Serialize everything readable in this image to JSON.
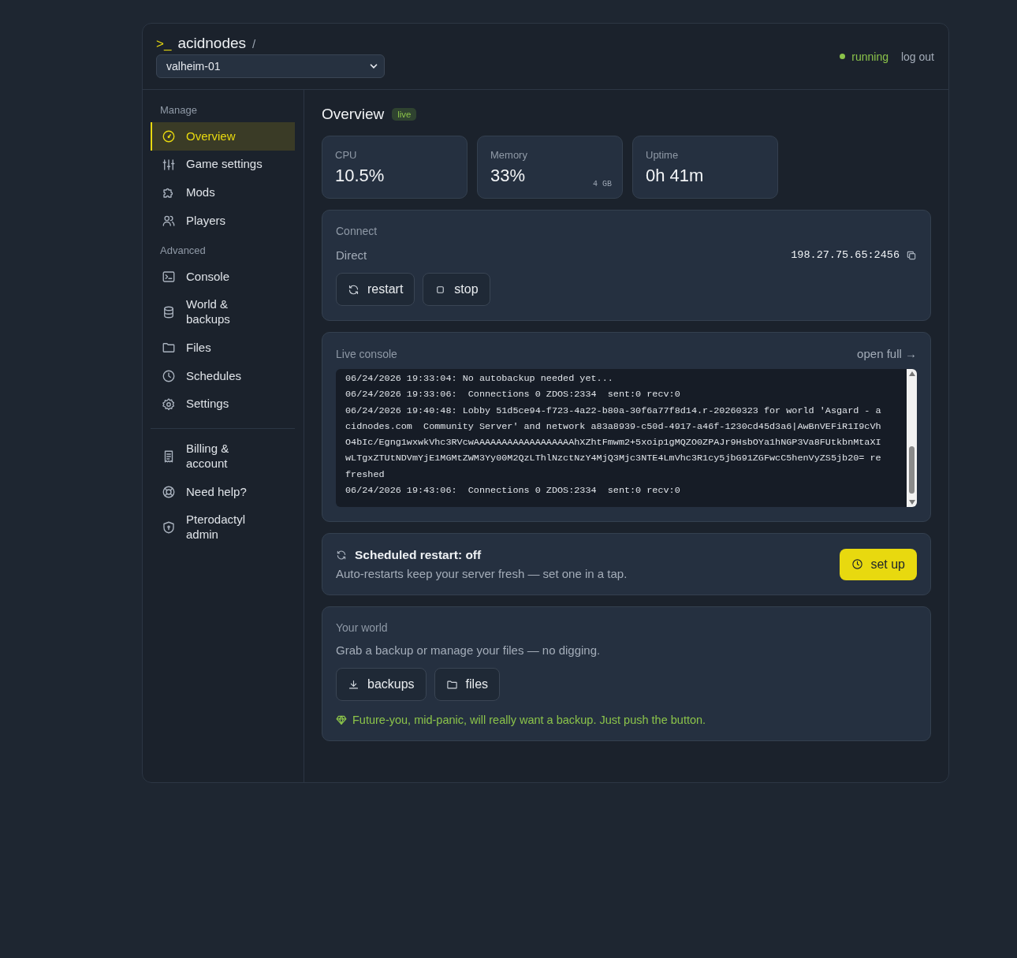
{
  "header": {
    "brand_prompt": ">_",
    "brand": "acidnodes",
    "separator": "/",
    "server_select": {
      "value": "valheim-01"
    },
    "status": {
      "label": "running",
      "color": "#8bc34a"
    },
    "logout": "log out"
  },
  "sidebar": {
    "sections": [
      {
        "title": "Manage",
        "items": [
          {
            "label": "Overview",
            "selected": true
          },
          {
            "label": "Game settings",
            "selected": false
          },
          {
            "label": "Mods",
            "selected": false
          },
          {
            "label": "Players",
            "selected": false
          }
        ]
      },
      {
        "title": "Advanced",
        "items": [
          {
            "label": "Console",
            "selected": false
          },
          {
            "label": "World & backups",
            "selected": false
          },
          {
            "label": "Files",
            "selected": false
          },
          {
            "label": "Schedules",
            "selected": false
          },
          {
            "label": "Settings",
            "selected": false
          }
        ]
      },
      {
        "items": [
          {
            "label": "Billing & account",
            "selected": false
          },
          {
            "label": "Need help?",
            "selected": false
          },
          {
            "label": "Pterodactyl admin",
            "selected": false
          }
        ]
      }
    ]
  },
  "main": {
    "title": "Overview",
    "badge": "live",
    "stats": [
      {
        "label": "CPU",
        "value": "10.5%"
      },
      {
        "label": "Memory",
        "value": "33%",
        "note": "4 GB"
      },
      {
        "label": "Uptime",
        "value": "0h 41m"
      }
    ],
    "connect": {
      "title": "Connect",
      "label": "Direct",
      "address": "198.27.75.65:2456",
      "buttons": [
        {
          "label": "restart"
        },
        {
          "label": "stop"
        }
      ]
    },
    "console": {
      "title": "Live console",
      "link": "open full →",
      "lines": [
        "06/24/2026 19:33:04: No autobackup needed yet...",
        "06/24/2026 19:33:06:  Connections 0 ZDOS:2334  sent:0 recv:0",
        "06/24/2026 19:40:48: Lobby 51d5ce94-f723-4a22-b80a-30f6a77f8d14.r-20260323 for world 'Asgard - acidnodes.com  Community Server' and network a83a8939-c50d-4917-a46f-1230cd45d3a6|AwBnVEFiR1I9cVhO4bIc/Egng1wxwkVhc3RVcwAAAAAAAAAAAAAAAAAAhXZhtFmwm2+5xoip1gMQZO0ZPAJr9HsbOYa1hNGP3Va8FUtkbnMtaXIwLTgxZTUtNDVmYjE1MGMtZWM3Yy00M2QzLThlNzctNzY4MjQ3Mjc3NTE4LmVhc3R1cy5jbG91ZGFwcC5henVyZS5jb20= refreshed",
        "06/24/2026 19:43:06:  Connections 0 ZDOS:2334  sent:0 recv:0"
      ]
    },
    "schedule": {
      "title": "Scheduled restart: off",
      "text": "Auto-restarts keep your server fresh — set one in a tap.",
      "button": "set up"
    },
    "world": {
      "title": "Your world",
      "text": "Grab a backup or manage your files — no digging.",
      "buttons": [
        {
          "label": "backups"
        },
        {
          "label": "files"
        }
      ],
      "tip": "Future-you, mid-panic, will really want a backup. Just push the button."
    }
  }
}
